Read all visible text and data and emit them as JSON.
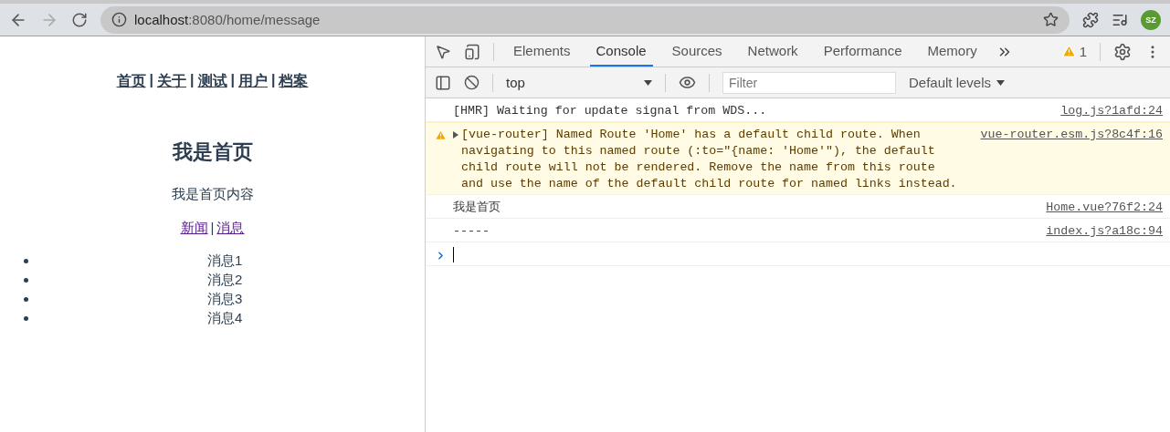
{
  "browser": {
    "url_host": "localhost",
    "url_rest": ":8080/home/message",
    "avatar": "SZ"
  },
  "page": {
    "nav": [
      {
        "kind": "link",
        "text": "首页"
      },
      {
        "kind": "separator",
        "text": "|"
      },
      {
        "kind": "link",
        "text": "关于"
      },
      {
        "kind": "separator",
        "text": "|"
      },
      {
        "kind": "link",
        "text": "测试"
      },
      {
        "kind": "separator",
        "text": "|"
      },
      {
        "kind": "link",
        "text": "用户"
      },
      {
        "kind": "separator",
        "text": "|"
      },
      {
        "kind": "link",
        "text": "档案"
      }
    ],
    "heading": "我是首页",
    "content": "我是首页内容",
    "subnav": [
      {
        "kind": "link",
        "text": "新闻"
      },
      {
        "kind": "separator",
        "text": "|"
      },
      {
        "kind": "link",
        "text": "消息"
      }
    ],
    "messages": [
      "消息1",
      "消息2",
      "消息3",
      "消息4"
    ]
  },
  "devtools": {
    "tabs": [
      {
        "label": "Elements",
        "selected": false
      },
      {
        "label": "Console",
        "selected": true
      },
      {
        "label": "Sources",
        "selected": false
      },
      {
        "label": "Network",
        "selected": false
      },
      {
        "label": "Performance",
        "selected": false
      },
      {
        "label": "Memory",
        "selected": false
      }
    ],
    "warning_count": "1",
    "context": "top",
    "filter_placeholder": "Filter",
    "levels": "Default levels",
    "console": [
      {
        "kind": "log",
        "text": "[HMR] Waiting for update signal from WDS...",
        "source": "log.js?1afd:24"
      },
      {
        "kind": "warning",
        "text": "[vue-router] Named Route 'Home' has a default child route. When navigating to this named route (:to=\"{name: 'Home'\"), the default child route will not be rendered. Remove the name from this route and use the name of the default child route for named links instead.",
        "source": "vue-router.esm.js?8c4f:16"
      },
      {
        "kind": "log",
        "text": "我是首页",
        "source": "Home.vue?76f2:24"
      },
      {
        "kind": "log",
        "text": "-----",
        "source": "index.js?a18c:94"
      }
    ]
  }
}
